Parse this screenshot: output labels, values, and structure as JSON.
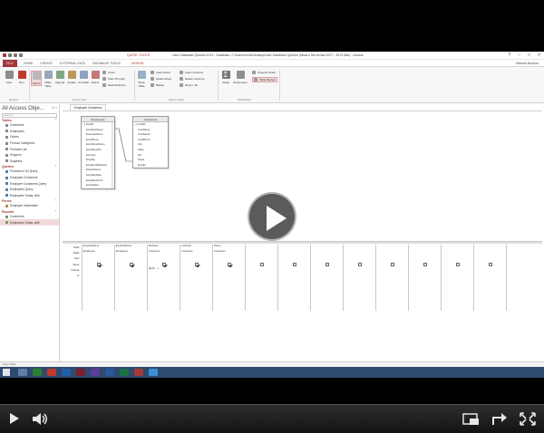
{
  "window": {
    "context_tab": "QUERY TOOLS",
    "title": "User Database Queries 2013 : Database- C:\\Users\\mcfe\\Desktop\\User Database Queries (Ntwa-n file format 2007 - 2013 files) - Access",
    "buttons": [
      "?",
      "−",
      "□",
      "×"
    ]
  },
  "ribbon_tabs": [
    {
      "label": "FILE"
    },
    {
      "label": "HOME"
    },
    {
      "label": "CREATE"
    },
    {
      "label": "EXTERNAL DATA"
    },
    {
      "label": "DATABASE TOOLS"
    },
    {
      "label": "DESIGN"
    }
  ],
  "user": "Mikeala Badadu",
  "ribbon": {
    "results": [
      {
        "label": "View"
      },
      {
        "label": "Run"
      }
    ],
    "query_type": [
      {
        "label": "Select"
      },
      {
        "label": "Make Table"
      },
      {
        "label": "Append"
      },
      {
        "label": "Update"
      },
      {
        "label": "Crosstab"
      },
      {
        "label": "Delete"
      }
    ],
    "query_type_small": [
      "Union",
      "Pass-Through",
      "Data Definition"
    ],
    "show_table": "Show Table",
    "query_setup_small": [
      "Insert Rows",
      "Delete Rows",
      "Builder",
      "Insert Columns",
      "Delete Columns",
      "Return: All"
    ],
    "totals": "Totals",
    "parameters": "Parameters",
    "show_hide_small": [
      "Property Sheet",
      "Table Names"
    ],
    "groups": [
      "Results",
      "Query Type",
      "Query Setup",
      "Show/Hide"
    ]
  },
  "nav": {
    "title": "All Access Obje...",
    "search_placeholder": "Search...",
    "sections": [
      {
        "label": "Tables",
        "items": [
          "Customers",
          "Employees",
          "Orders",
          "Product Categories",
          "Products List",
          "Shippers",
          "Suppliers"
        ]
      },
      {
        "label": "Queries",
        "items": [
          "Products in NJ Query",
          "Employee Customers",
          "Employee Customers Query",
          "Employees Query",
          "Employees Today: with"
        ]
      },
      {
        "label": "Forms",
        "items": [
          "Employee Information"
        ]
      },
      {
        "label": "Reports",
        "items": [
          "Customers",
          "Employees Today: with"
        ]
      }
    ]
  },
  "doc_tab": "Employee Customers",
  "tables": [
    {
      "title": "Employees",
      "key": "EmpID",
      "fields": [
        "EmpFirstName",
        "EmpLastName",
        "EmpPhone",
        "EmpStreetName",
        "EmpStreetNo",
        "EmpCity",
        "EmpZip",
        "EmpEmailAddress",
        "EmpAddress",
        "EmpHireDate",
        "EmpReportsTo",
        "EmpStatus"
      ]
    },
    {
      "title": "Customers",
      "key": "CustID",
      "fields": [
        "CustName",
        "CustSaved",
        "CustPhone",
        "City",
        "State",
        "Zip",
        "Notes",
        "EmpID"
      ]
    }
  ],
  "grid": {
    "row_labels": [
      "Field:",
      "Table:",
      "Sort:",
      "Show:",
      "Criteria:",
      "or:"
    ],
    "columns": [
      {
        "field": "EmpLastName",
        "table": "Employees",
        "show": true
      },
      {
        "field": "EmpFirstName",
        "table": "Employees",
        "show": true
      },
      {
        "field": "Business",
        "table": "Customers",
        "show": true,
        "criteria": "[Enter ...]"
      },
      {
        "field": "CustCard",
        "table": "Customers",
        "show": true
      },
      {
        "field": "Phone",
        "table": "Customers",
        "show": true
      },
      {
        "field": "",
        "table": "",
        "show": false
      },
      {
        "field": "",
        "table": "",
        "show": false
      },
      {
        "field": "",
        "table": "",
        "show": false
      },
      {
        "field": "",
        "table": "",
        "show": false
      },
      {
        "field": "",
        "table": "",
        "show": false
      },
      {
        "field": "",
        "table": "",
        "show": false
      },
      {
        "field": "",
        "table": "",
        "show": false
      },
      {
        "field": "",
        "table": "",
        "show": false
      }
    ]
  },
  "status": "Form View",
  "video": {
    "progress": 0.0
  }
}
